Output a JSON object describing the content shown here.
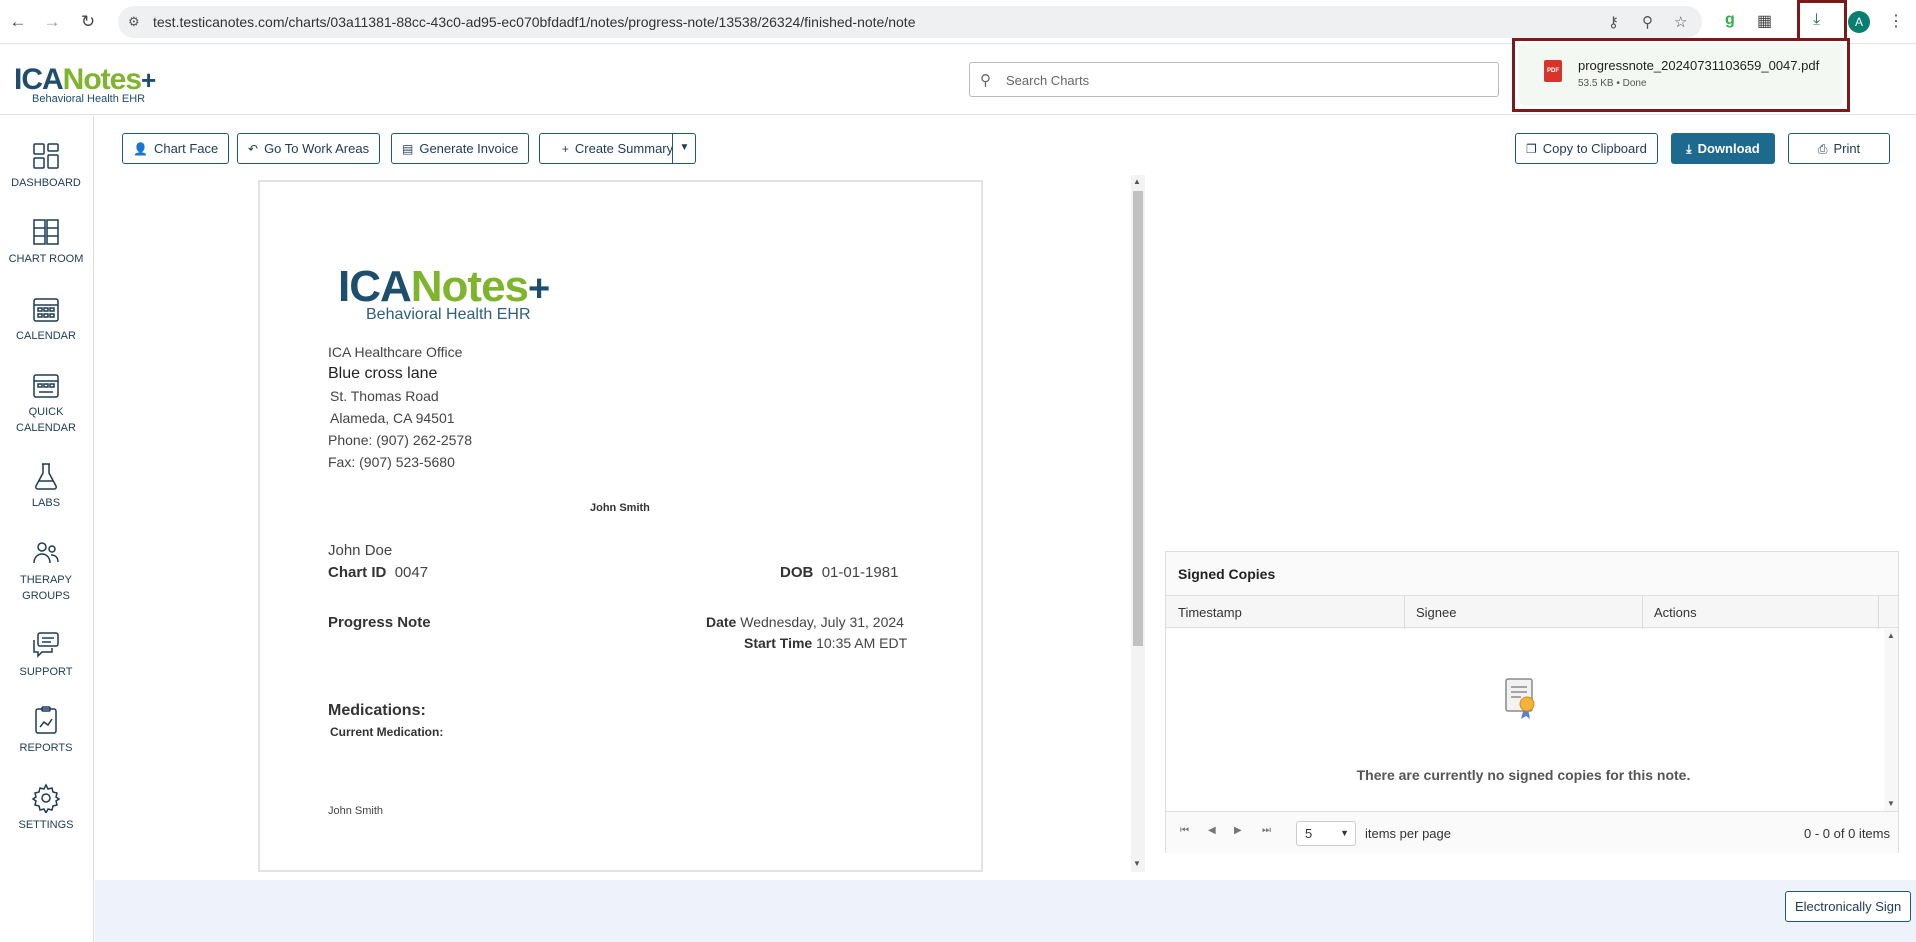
{
  "browser": {
    "url": "test.testicanotes.com/charts/03a11381-88cc-43c0-ad95-ec070bfdadf1/notes/progress-note/13538/26324/finished-note/note",
    "avatar_letter": "A",
    "download": {
      "filename": "progressnote_20240731103659_0047.pdf",
      "meta": "53.5 KB • Done",
      "badge": "PDF"
    }
  },
  "header": {
    "logo_ica": "ICA",
    "logo_notes": "Notes",
    "logo_plus": "+",
    "logo_sub": "Behavioral Health EHR",
    "search_placeholder": "Search Charts"
  },
  "sidebar": {
    "items": [
      {
        "label": "DASHBOARD",
        "icon": "dashboard-icon"
      },
      {
        "label": "CHART ROOM",
        "icon": "chart-room-icon"
      },
      {
        "label": "CALENDAR",
        "icon": "calendar-icon"
      },
      {
        "label": "QUICK CALENDAR",
        "icon": "quick-calendar-icon"
      },
      {
        "label": "LABS",
        "icon": "flask-icon"
      },
      {
        "label": "THERAPY GROUPS",
        "icon": "group-icon"
      },
      {
        "label": "SUPPORT",
        "icon": "chat-icon"
      },
      {
        "label": "REPORTS",
        "icon": "report-icon"
      },
      {
        "label": "SETTINGS",
        "icon": "gear-icon"
      }
    ]
  },
  "toolbar": {
    "chart_face": "Chart Face",
    "go_to_work_areas": "Go To Work Areas",
    "generate_invoice": "Generate Invoice",
    "create_summary": "Create Summary",
    "copy_to_clipboard": "Copy to Clipboard",
    "download": "Download",
    "print": "Print"
  },
  "document": {
    "office_name": "ICA Healthcare Office",
    "address_line1": "Blue cross lane",
    "address_line2": "St. Thomas Road",
    "address_line3": "Alameda, CA 94501",
    "phone": "Phone: (907) 262-2578",
    "fax": "Fax: (907) 523-5680",
    "header_name": "John Smith",
    "patient_name": "John Doe",
    "chart_id_label": "Chart ID",
    "chart_id": "0047",
    "dob_label": "DOB",
    "dob": "01-01-1981",
    "note_type": "Progress Note",
    "date_label": "Date",
    "date": "Wednesday, July 31, 2024",
    "start_time_label": "Start Time",
    "start_time": "10:35 AM EDT",
    "medications_heading": "Medications:",
    "current_medication_label": "Current Medication:",
    "footer_name": "John Smith"
  },
  "signed_copies": {
    "title": "Signed Copies",
    "columns": [
      "Timestamp",
      "Signee",
      "Actions"
    ],
    "empty_message": "There are currently no signed copies for this note.",
    "per_page": "5",
    "per_page_label": "items per page",
    "range": "0 - 0 of 0 items"
  },
  "footer": {
    "electronically_sign": "Electronically Sign"
  }
}
